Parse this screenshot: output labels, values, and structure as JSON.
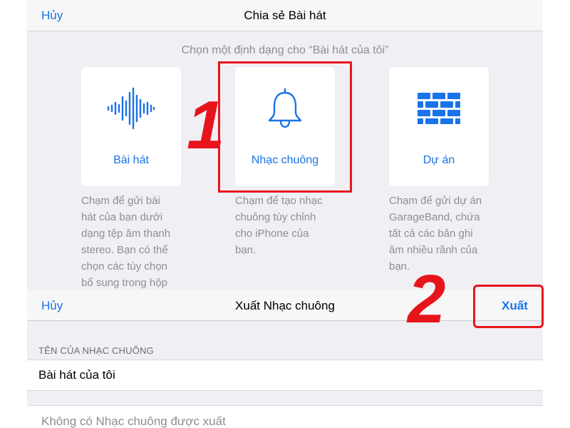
{
  "share_sheet": {
    "cancel_label": "Hủy",
    "title": "Chia sẻ Bài hát",
    "subtitle": "Chọn một định dạng cho “Bài hát của tôi”",
    "options": [
      {
        "icon": "waveform-icon",
        "label": "Bài hát",
        "description": [
          "Chạm để gửi bài",
          "hát của bạn dưới",
          "dạng tệp âm thanh",
          "stereo. Bạn có thể",
          "chọn các tùy chọn",
          "bổ sung trong hộp"
        ]
      },
      {
        "icon": "bell-icon",
        "label": "Nhạc chuông",
        "description": [
          "Chạm để tạo nhạc",
          "chuông tùy chỉnh",
          "cho iPhone của",
          "bạn."
        ]
      },
      {
        "icon": "brick-wall-icon",
        "label": "Dự án",
        "description": [
          "Chạm để gửi dự án",
          "GarageBand, chứa",
          "tất cả các bản ghi",
          "âm nhiều rãnh của",
          "bạn."
        ]
      }
    ]
  },
  "annotations": {
    "step1": "1",
    "step2": "2",
    "color": "#e8141b"
  },
  "export_sheet": {
    "cancel_label": "Hủy",
    "title": "Xuất Nhạc chuông",
    "export_label": "Xuất",
    "section_header": "TÊN CỦA NHẠC CHUÔNG",
    "ringtone_name": "Bài hát của tôi",
    "status_text": "Không có Nhạc chuông được xuất"
  },
  "colors": {
    "accent": "#1a73e8",
    "background": "#efeff4",
    "secondary_text": "#8e8e93"
  }
}
